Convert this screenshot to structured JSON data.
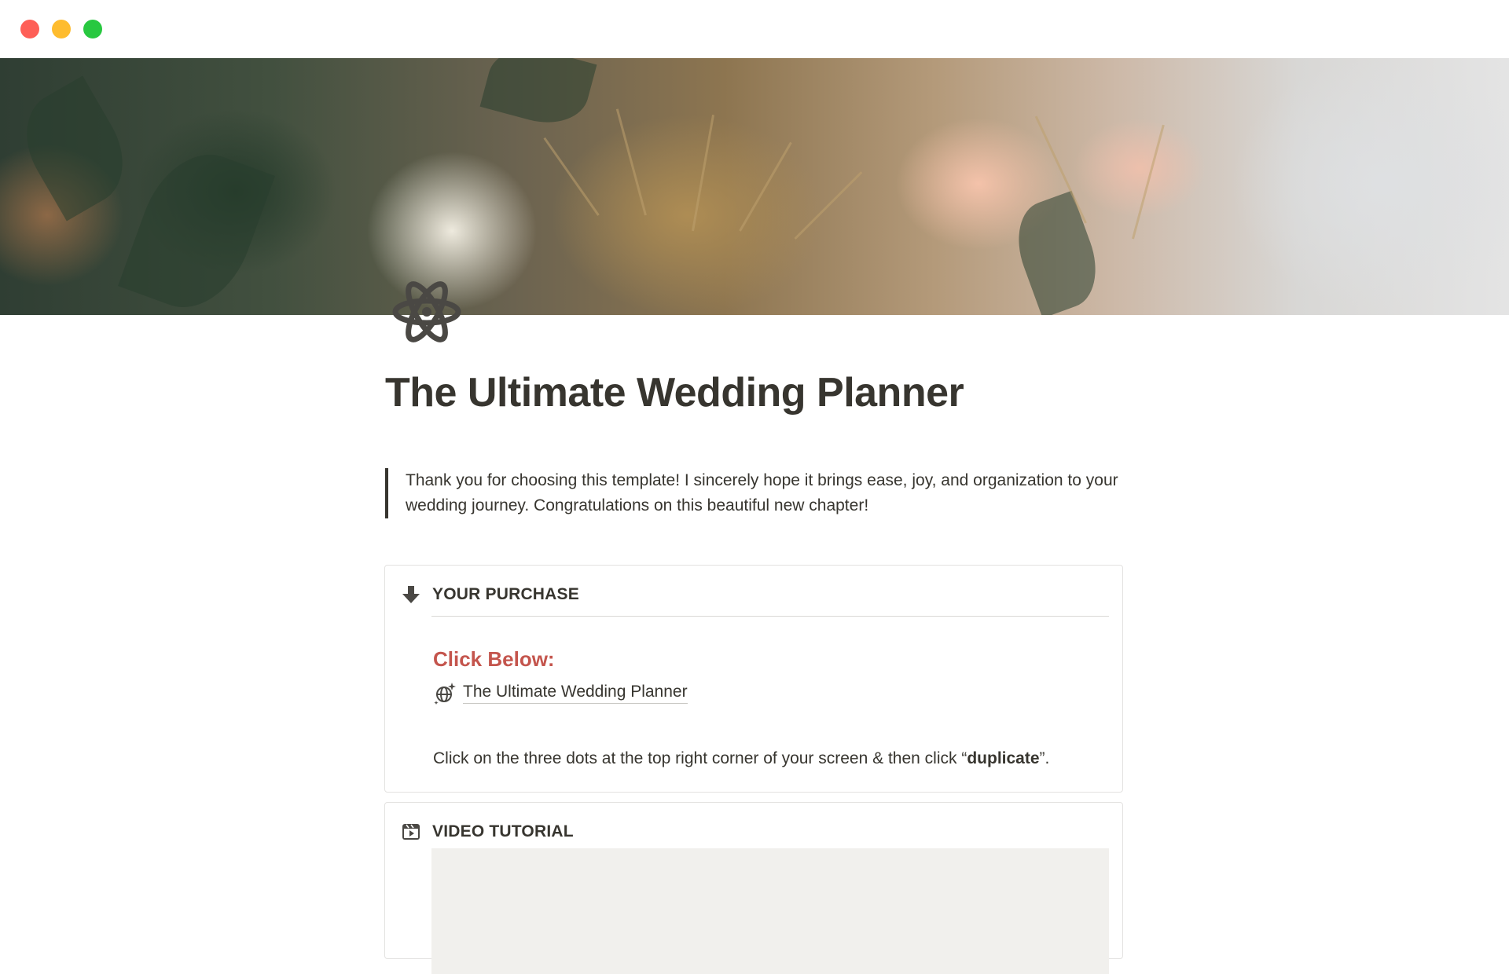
{
  "window": {
    "controls": [
      "close",
      "minimize",
      "zoom"
    ],
    "colors": {
      "close": "#fe5f57",
      "minimize": "#febc2e",
      "zoom": "#28c840"
    }
  },
  "page": {
    "icon": "atom-icon",
    "title": "The Ultimate Wedding Planner",
    "quote": "Thank you for choosing this template! I sincerely hope it brings ease, joy, and organization to your wedding journey. Congratulations on this beautiful new chapter!"
  },
  "purchase": {
    "icon": "arrow-down-icon",
    "heading": "YOUR PURCHASE",
    "click_label": "Click Below:",
    "link_icon": "globe-sparkle-icon",
    "link_text": "The Ultimate Wedding Planner",
    "instruction_before": "Click on the three dots at the top right corner of your screen & then click “",
    "instruction_bold": "duplicate",
    "instruction_after": "”."
  },
  "video": {
    "icon": "clapperboard-icon",
    "heading": "VIDEO TUTORIAL"
  },
  "colors": {
    "text": "#37352f",
    "accent_red": "#c4554d",
    "border": "#e3e2e0",
    "embed_bg": "#f1f0ed"
  }
}
